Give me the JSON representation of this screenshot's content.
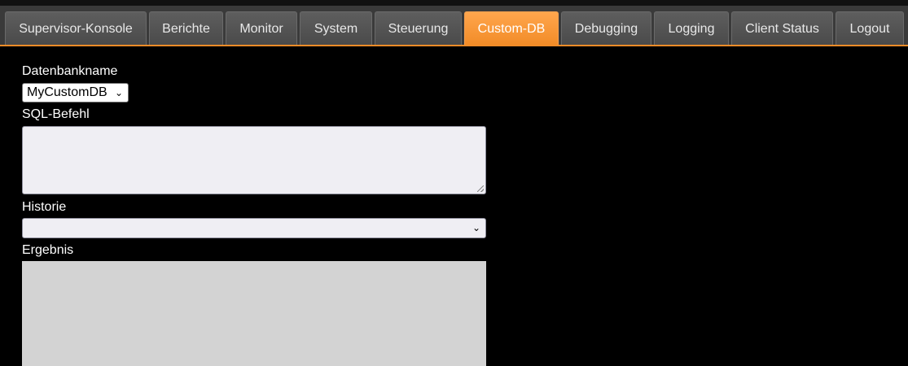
{
  "tabs": [
    {
      "label": "Supervisor-Konsole",
      "active": false
    },
    {
      "label": "Berichte",
      "active": false
    },
    {
      "label": "Monitor",
      "active": false
    },
    {
      "label": "System",
      "active": false
    },
    {
      "label": "Steuerung",
      "active": false
    },
    {
      "label": "Custom-DB",
      "active": true
    },
    {
      "label": "Debugging",
      "active": false
    },
    {
      "label": "Logging",
      "active": false
    },
    {
      "label": "Client Status",
      "active": false
    },
    {
      "label": "Logout",
      "active": false
    }
  ],
  "form": {
    "database_label": "Datenbankname",
    "database_value": "MyCustomDB",
    "sql_label": "SQL-Befehl",
    "sql_value": "",
    "history_label": "Historie",
    "history_value": "",
    "result_label": "Ergebnis"
  },
  "colors": {
    "accent": "#f28c28",
    "background": "#000000",
    "tab": "#4f4f4f",
    "result_area": "#d3d3d3"
  },
  "icons": {
    "dropdown": "chevron-down-icon",
    "resize": "resize-grip-icon"
  }
}
